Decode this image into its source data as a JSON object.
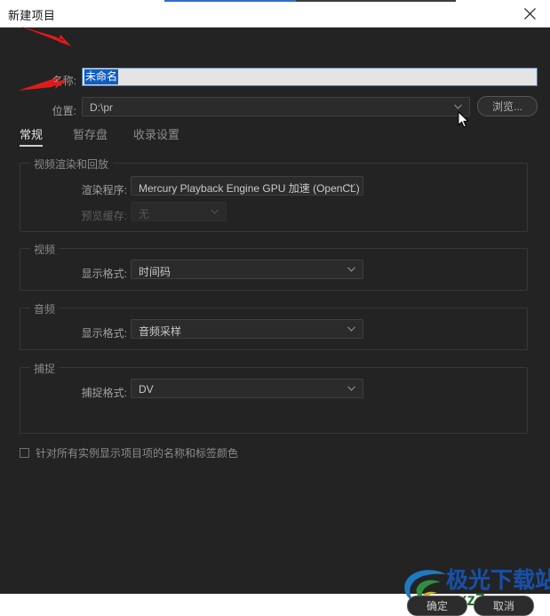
{
  "window": {
    "title": "新建项目",
    "close_icon": "close-icon"
  },
  "fields": {
    "name_label": "名称:",
    "name_value": "未命名",
    "location_label": "位置:",
    "location_value": "D:\\pr",
    "browse_label": "浏览..."
  },
  "tabs": [
    {
      "label": "常规",
      "active": true
    },
    {
      "label": "暂存盘",
      "active": false
    },
    {
      "label": "收录设置",
      "active": false
    }
  ],
  "groups": {
    "video_render": {
      "title": "视频渲染和回放",
      "renderer_label": "渲染程序:",
      "renderer_value": "Mercury Playback Engine GPU 加速 (OpenCL)",
      "preview_cache_label": "预览缓存:",
      "preview_cache_value": "无"
    },
    "video": {
      "title": "视频",
      "display_format_label": "显示格式:",
      "display_format_value": "时间码"
    },
    "audio": {
      "title": "音频",
      "display_format_label": "显示格式:",
      "display_format_value": "音频采样"
    },
    "capture": {
      "title": "捕捉",
      "capture_format_label": "捕捉格式:",
      "capture_format_value": "DV"
    }
  },
  "checkbox": {
    "label": "针对所有实例显示项目项的名称和标签颜色",
    "checked": false
  },
  "buttons": {
    "ok": "确定",
    "cancel": "取消"
  },
  "watermark": {
    "brand": "极光下载站",
    "url": "www.xz7.com"
  },
  "colors": {
    "window_bg": "#232323",
    "titlebar_bg": "#ffffff",
    "accent_focus": "#3a76c4",
    "selection_blue": "#0f5ec4",
    "arrow_red": "#e01b1b",
    "watermark_blue": "#1a4fa3",
    "watermark_green": "#1f6b2e"
  }
}
